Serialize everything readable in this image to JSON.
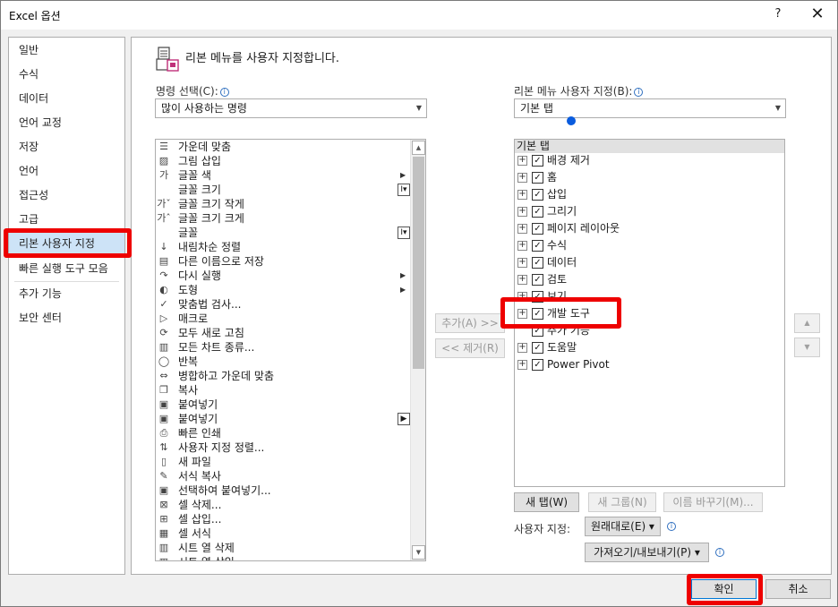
{
  "window": {
    "title": "Excel 옵션",
    "help": "?",
    "close": "✕"
  },
  "nav": [
    "일반",
    "수식",
    "데이터",
    "언어 교정",
    "저장",
    "언어",
    "접근성",
    "고급",
    "리본 사용자 지정",
    "빠른 실행 도구 모음",
    "추가 기능",
    "보안 센터"
  ],
  "nav_active": "리본 사용자 지정",
  "main": {
    "heading": "리본 메뉴를 사용자 지정합니다.",
    "commands_label": "명령 선택(C):",
    "commands_combo": "많이 사용하는 명령",
    "ribbon_label": "리본 메뉴 사용자 지정(B):",
    "ribbon_combo": "기본 탭"
  },
  "commands": [
    {
      "icon": "center-align-icon",
      "glyph": "☰",
      "label": "가운데 맞춤"
    },
    {
      "icon": "insert-picture-icon",
      "glyph": "▨",
      "label": "그림 삽입"
    },
    {
      "icon": "font-color-icon",
      "glyph": "가",
      "label": "글꼴 색",
      "sub": "▶"
    },
    {
      "icon": "font-size-icon",
      "glyph": "",
      "label": "글꼴 크기",
      "box": "I▾"
    },
    {
      "icon": "decrease-font-icon",
      "glyph": "가ˇ",
      "label": "글꼴 크기 작게"
    },
    {
      "icon": "increase-font-icon",
      "glyph": "가ˆ",
      "label": "글꼴 크기 크게"
    },
    {
      "icon": "font-icon",
      "glyph": "",
      "label": "글꼴",
      "box": "I▾"
    },
    {
      "icon": "sort-descending-icon",
      "glyph": "↓",
      "label": "내림차순 정렬"
    },
    {
      "icon": "save-as-icon",
      "glyph": "▤",
      "label": "다른 이름으로 저장"
    },
    {
      "icon": "redo-icon",
      "glyph": "↷",
      "label": "다시 실행",
      "sub": "▶"
    },
    {
      "icon": "shapes-icon",
      "glyph": "◐",
      "label": "도형",
      "sub": "▶"
    },
    {
      "icon": "spelling-icon",
      "glyph": "✓",
      "label": "맞춤법 검사..."
    },
    {
      "icon": "macro-icon",
      "glyph": "▷",
      "label": "매크로"
    },
    {
      "icon": "refresh-all-icon",
      "glyph": "⟳",
      "label": "모두 새로 고침"
    },
    {
      "icon": "all-chart-types-icon",
      "glyph": "▥",
      "label": "모든 차트 종류..."
    },
    {
      "icon": "repeat-icon",
      "glyph": "◯",
      "label": "반복"
    },
    {
      "icon": "merge-center-icon",
      "glyph": "⇔",
      "label": "병합하고 가운데 맞춤"
    },
    {
      "icon": "copy-icon",
      "glyph": "❐",
      "label": "복사"
    },
    {
      "icon": "paste-icon",
      "glyph": "▣",
      "label": "붙여넣기"
    },
    {
      "icon": "paste-dropdown-icon",
      "glyph": "▣",
      "label": "붙여넣기",
      "box": "▶"
    },
    {
      "icon": "quick-print-icon",
      "glyph": "⎙",
      "label": "빠른 인쇄"
    },
    {
      "icon": "custom-sort-icon",
      "glyph": "⇅",
      "label": "사용자 지정 정렬..."
    },
    {
      "icon": "new-file-icon",
      "glyph": "▯",
      "label": "새 파일"
    },
    {
      "icon": "format-painter-icon",
      "glyph": "✎",
      "label": "서식 복사"
    },
    {
      "icon": "paste-special-icon",
      "glyph": "▣",
      "label": "선택하여 붙여넣기..."
    },
    {
      "icon": "delete-cells-icon",
      "glyph": "⊠",
      "label": "셀 삭제..."
    },
    {
      "icon": "insert-cells-icon",
      "glyph": "⊞",
      "label": "셀 삽입..."
    },
    {
      "icon": "format-cells-icon",
      "glyph": "▦",
      "label": "셀 서식"
    },
    {
      "icon": "delete-sheet-columns-icon",
      "glyph": "▥",
      "label": "시트 열 삭제"
    },
    {
      "icon": "insert-sheet-columns-icon",
      "glyph": "▥",
      "label": "시트 열 삽입"
    }
  ],
  "tabs_header": "기본 탭",
  "tabs": [
    {
      "label": "배경 제거",
      "expander": "+",
      "checked": "✓"
    },
    {
      "label": "홈",
      "expander": "+",
      "checked": "✓"
    },
    {
      "label": "삽입",
      "expander": "+",
      "checked": "✓"
    },
    {
      "label": "그리기",
      "expander": "+",
      "checked": "✓"
    },
    {
      "label": "페이지 레이아웃",
      "expander": "+",
      "checked": "✓"
    },
    {
      "label": "수식",
      "expander": "+",
      "checked": "✓"
    },
    {
      "label": "데이터",
      "expander": "+",
      "checked": "✓"
    },
    {
      "label": "검토",
      "expander": "+",
      "checked": "✓"
    },
    {
      "label": "보기",
      "expander": "+",
      "checked": "✓"
    },
    {
      "label": "개발 도구",
      "expander": "+",
      "checked": "✓"
    },
    {
      "label": "추가 기능",
      "expander": "",
      "checked": "✓"
    },
    {
      "label": "도움말",
      "expander": "+",
      "checked": "✓"
    },
    {
      "label": "Power Pivot",
      "expander": "+",
      "checked": "✓"
    }
  ],
  "buttons": {
    "add": "추가(A) >>",
    "remove": "<< 제거(R)",
    "new_tab": "새 탭(W)",
    "new_group": "새 그룹(N)",
    "rename": "이름 바꾸기(M)...",
    "customize_label": "사용자 지정:",
    "reset": "원래대로(E) ▾",
    "import_export": "가져오기/내보내기(P) ▾",
    "move_up": "▲",
    "move_down": "▼",
    "ok": "확인",
    "cancel": "취소"
  },
  "info_glyph": "i",
  "colors": {
    "highlight": "#ee0000",
    "accent": "#0078d7",
    "active_nav": "#cde3f7"
  }
}
